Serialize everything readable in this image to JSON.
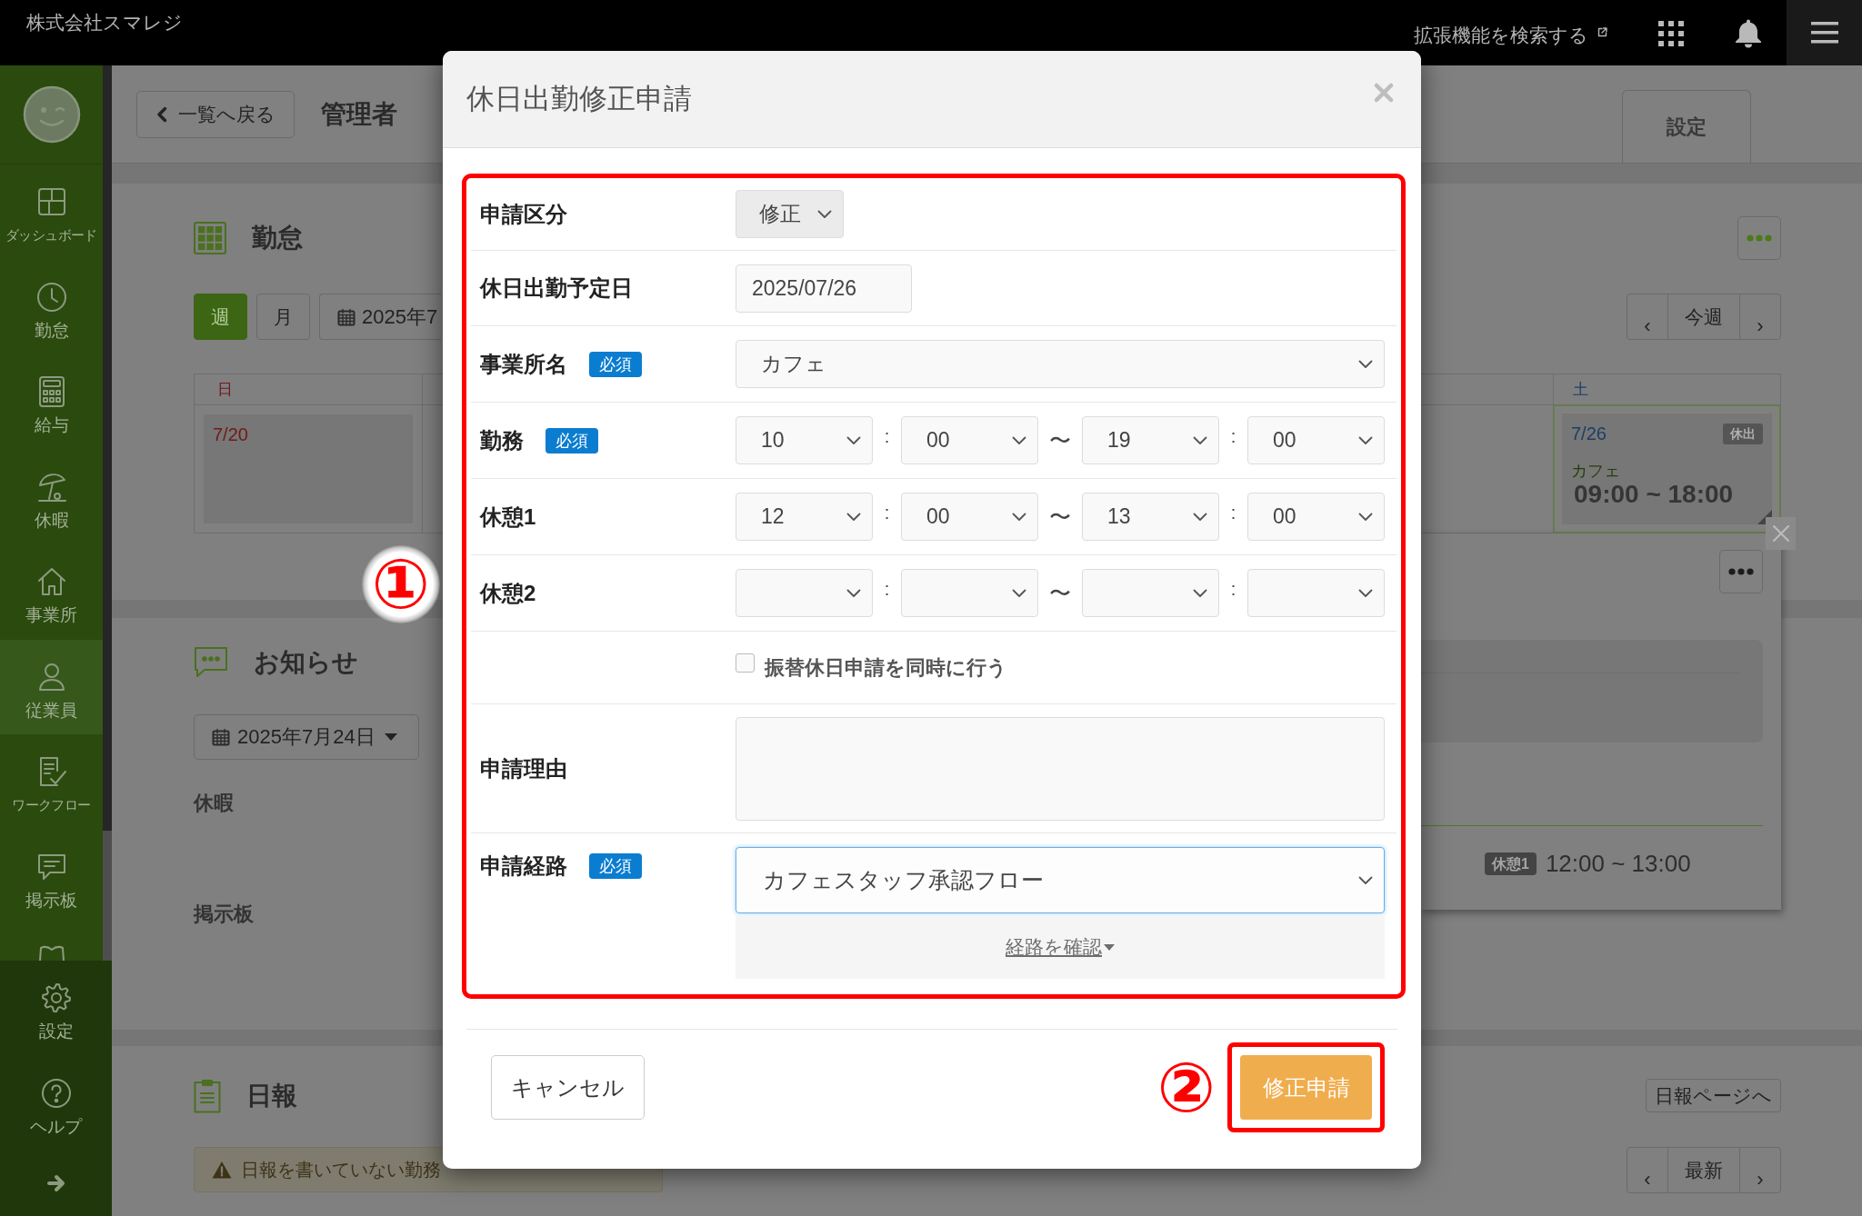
{
  "top_bar": {
    "company": "株式会社スマレジ",
    "extension_search": "拡張機能を検索する"
  },
  "sidebar": {
    "items": [
      {
        "label": "ダッシュボード",
        "selected": false
      },
      {
        "label": "勤怠",
        "selected": false
      },
      {
        "label": "給与",
        "selected": false
      },
      {
        "label": "休暇",
        "selected": false
      },
      {
        "label": "事業所",
        "selected": false
      },
      {
        "label": "従業員",
        "selected": true
      },
      {
        "label": "ワークフロー",
        "selected": false
      },
      {
        "label": "掲示板",
        "selected": false
      }
    ],
    "footer_items": [
      {
        "label": "設定"
      },
      {
        "label": "ヘルプ"
      }
    ]
  },
  "header": {
    "back": "一覧へ戻る",
    "title": "管理者",
    "tab": "設定"
  },
  "attendance": {
    "title": "勤怠",
    "views": [
      {
        "label": "週",
        "selected": true
      },
      {
        "label": "月",
        "selected": false
      }
    ],
    "date_picker": "2025年7",
    "week_nav": {
      "prev": "‹",
      "label": "今週",
      "next": "›"
    },
    "days": [
      {
        "label": "日",
        "date": "7/20",
        "color": "#741818",
        "selected": false
      },
      {
        "label": "土",
        "date": "7/26",
        "color": "#1d3d68",
        "selected": true,
        "badge": "休出",
        "location": "カフェ",
        "time": "09:00 ~ 18:00"
      }
    ],
    "detail": {
      "break_badge": "休憩1",
      "break_time": "12:00 ~ 13:00"
    }
  },
  "notices": {
    "title": "お知らせ",
    "date": "2025年7月24日",
    "categories": [
      "休暇",
      "掲示板"
    ]
  },
  "daily_report": {
    "title": "日報",
    "page_button": "日報ページへ",
    "warning": "日報を書いていない勤務",
    "nav": {
      "prev": "‹",
      "label": "最新",
      "next": "›"
    }
  },
  "modal": {
    "title": "休日出勤修正申請",
    "rows": [
      {
        "kind": "compact",
        "label": "申請区分",
        "value": "修正",
        "disabled": true
      },
      {
        "kind": "date",
        "label": "休日出勤予定日",
        "value": "2025/07/26"
      },
      {
        "kind": "select",
        "label": "事業所名",
        "badge": "必須",
        "value": "カフェ"
      },
      {
        "kind": "time",
        "label": "勤務",
        "badge": "必須",
        "start": {
          "hour": "10",
          "colon": ":",
          "minute": "00"
        },
        "tilde": "〜",
        "end": {
          "hour": "19",
          "colon": ":",
          "minute": "00"
        }
      },
      {
        "kind": "time",
        "label": "休憩1",
        "start": {
          "hour": "12",
          "colon": ":",
          "minute": "00"
        },
        "tilde": "〜",
        "end": {
          "hour": "13",
          "colon": ":",
          "minute": "00"
        }
      },
      {
        "kind": "time",
        "label": "休憩2",
        "start": {
          "colon": ":"
        },
        "tilde": "〜",
        "end": {
          "colon": ":"
        }
      },
      {
        "kind": "checkbox",
        "text": "振替休日申請を同時に行う",
        "checked": false
      },
      {
        "kind": "textarea",
        "label": "申請理由"
      },
      {
        "kind": "route",
        "label": "申請経路",
        "badge": "必須",
        "value": "カフェスタッフ承認フロー",
        "focused": true,
        "link": "経路を確認"
      }
    ],
    "cancel": "キャンセル",
    "submit": "修正申請"
  },
  "annotations": [
    {
      "number": "①"
    },
    {
      "number": "②"
    }
  ]
}
